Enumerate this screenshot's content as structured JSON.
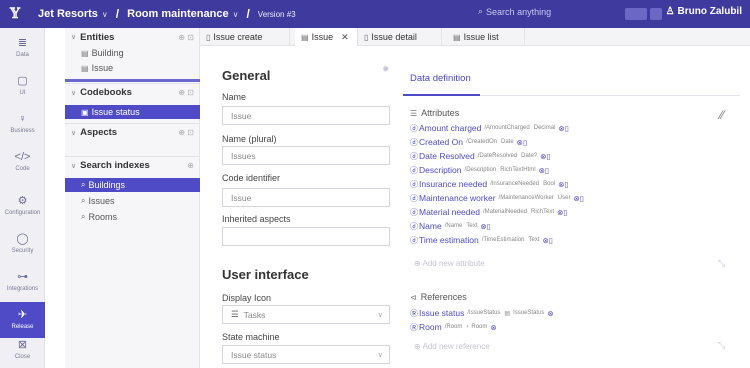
{
  "header": {
    "logo": "𝕐",
    "project": "Jet Resorts",
    "page": "Room maintenance",
    "version": "Version #3",
    "search_placeholder": "Search anything",
    "user": "Bruno Zalubil"
  },
  "rail": [
    {
      "label": "Data",
      "icon": "≣"
    },
    {
      "label": "UI",
      "icon": "▢"
    },
    {
      "label": "Business",
      "icon": "♀"
    },
    {
      "label": "Code",
      "icon": "</>"
    },
    {
      "label": "Configuration",
      "icon": "⚙"
    },
    {
      "label": "Security",
      "icon": "◯"
    },
    {
      "label": "Integrations",
      "icon": "⊶"
    },
    {
      "label": "Release",
      "icon": "✈"
    },
    {
      "label": "Close",
      "icon": "⊠"
    }
  ],
  "tree": {
    "entities": {
      "title": "Entities",
      "items": [
        "Building",
        "Issue"
      ]
    },
    "codebooks": {
      "title": "Codebooks",
      "items": [
        "Issue status"
      ]
    },
    "aspects": {
      "title": "Aspects"
    },
    "search_indexes": {
      "title": "Search indexes",
      "items": [
        "Buildings",
        "Issues",
        "Rooms"
      ]
    }
  },
  "tabs": [
    {
      "label": "Issue create",
      "active": false
    },
    {
      "label": "Issue",
      "active": true
    },
    {
      "label": "Issue detail",
      "active": false
    },
    {
      "label": "Issue list",
      "active": false
    }
  ],
  "form": {
    "general_title": "General",
    "name_label": "Name",
    "name_value": "Issue",
    "plural_label": "Name (plural)",
    "plural_value": "Issues",
    "code_label": "Code identifier",
    "code_value": "Issue",
    "aspects_label": "Inherited aspects",
    "aspects_value": "",
    "ui_title": "User interface",
    "icon_label": "Display Icon",
    "icon_value": "Tasks",
    "state_label": "State machine",
    "state_value": "Issue status"
  },
  "definition": {
    "tab": "Data definition",
    "attributes_title": "Attributes",
    "attributes": [
      {
        "name": "Amount charged",
        "path": "/AmountCharged",
        "type": "Decimal"
      },
      {
        "name": "Created On",
        "path": "/CreatedOn",
        "type": "Date"
      },
      {
        "name": "Date Resolved",
        "path": "/DateResolved",
        "type": "Date?"
      },
      {
        "name": "Description",
        "path": "/Description",
        "type": "RichTextHtml"
      },
      {
        "name": "Insurance needed",
        "path": "/InsuranceNeeded",
        "type": "Bool"
      },
      {
        "name": "Maintenance worker",
        "path": "/MaintenanceWorker",
        "type": "User"
      },
      {
        "name": "Material needed",
        "path": "/MaterialNeeded",
        "type": "RichText"
      },
      {
        "name": "Name",
        "path": "/Name",
        "type": "Text"
      },
      {
        "name": "Time estimation",
        "path": "/TimeEstimation",
        "type": "Text"
      }
    ],
    "add_attribute": "Add new attribute",
    "references_title": "References",
    "references": [
      {
        "name": "Issue status",
        "path": "/IssueStatus",
        "target": "IssueStatus"
      },
      {
        "name": "Room",
        "path": "/Room",
        "target": "Room"
      }
    ],
    "add_reference": "Add new reference"
  },
  "colors": {
    "topbar": "#3e3a9e",
    "accent": "#4f4bc7"
  }
}
